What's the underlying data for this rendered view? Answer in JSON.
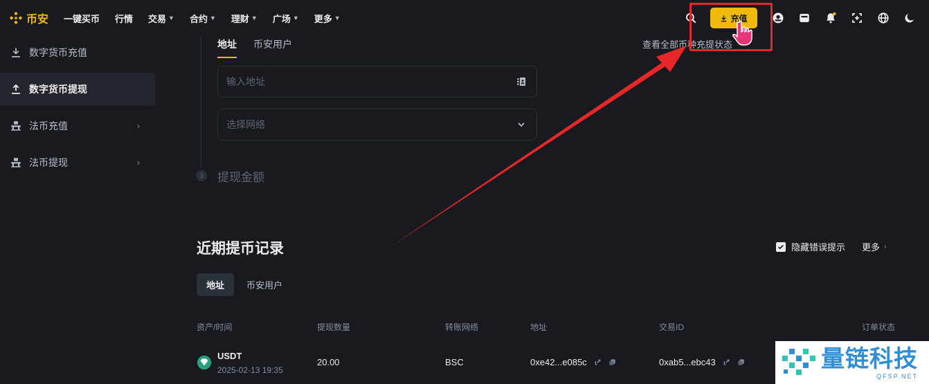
{
  "brand": {
    "name": "币安",
    "color": "#f0b90b"
  },
  "nav": {
    "items": [
      {
        "label": "一键买币",
        "has_dropdown": false
      },
      {
        "label": "行情",
        "has_dropdown": false
      },
      {
        "label": "交易",
        "has_dropdown": true
      },
      {
        "label": "合约",
        "has_dropdown": true
      },
      {
        "label": "理财",
        "has_dropdown": true
      },
      {
        "label": "广场",
        "has_dropdown": true
      },
      {
        "label": "更多",
        "has_dropdown": true
      }
    ],
    "deposit_label": "充值",
    "icons": [
      "search-icon",
      "user-icon",
      "wallet-icon",
      "notification-bell-icon",
      "download-app-icon",
      "globe-icon",
      "dark-mode-icon"
    ]
  },
  "overlap_text": "查看全部币种充提状态",
  "sidebar": {
    "items": [
      {
        "label": "数字货币充值",
        "icon": "download-icon",
        "active": false,
        "has_arrow": false
      },
      {
        "label": "数字货币提现",
        "icon": "upload-icon",
        "active": true,
        "has_arrow": false
      },
      {
        "label": "法币充值",
        "icon": "bank-icon",
        "active": false,
        "has_arrow": true
      },
      {
        "label": "法币提现",
        "icon": "bank-icon",
        "active": false,
        "has_arrow": true
      }
    ]
  },
  "withdraw_form": {
    "tabs": [
      {
        "label": "地址",
        "active": true
      },
      {
        "label": "币安用户",
        "active": false
      }
    ],
    "address_placeholder": "输入地址",
    "network_placeholder": "选择网络",
    "step3_number": "3",
    "step3_label": "提现金额"
  },
  "records": {
    "title": "近期提币记录",
    "hide_errors_label": "隐藏错误提示",
    "hide_errors_checked": true,
    "more_label": "更多",
    "tabs": [
      {
        "label": "地址",
        "active": true
      },
      {
        "label": "币安用户",
        "active": false
      }
    ],
    "columns": [
      "资产/时间",
      "提现数量",
      "转账网络",
      "地址",
      "交易ID",
      "订单状态"
    ],
    "rows": [
      {
        "asset": "USDT",
        "time": "2025-02-13 19:35",
        "amount": "20.00",
        "network": "BSC",
        "address": "0xe42...e085c",
        "txid": "0xab5...ebc43"
      }
    ]
  },
  "watermark": {
    "main": "量链科技",
    "sub": "QFSP.NET"
  },
  "colors": {
    "background": "#181a20",
    "accent": "#f0b90b",
    "annotation_red": "#e82828",
    "usdt_green": "#26a17b"
  }
}
